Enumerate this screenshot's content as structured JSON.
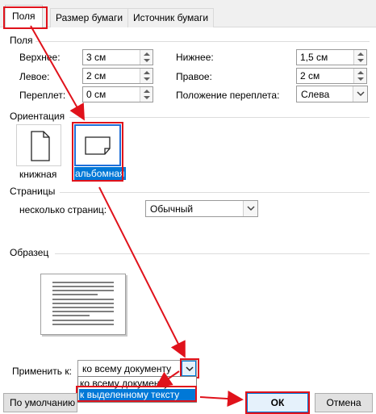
{
  "tabs": [
    "Поля",
    "Размер бумаги",
    "Источник бумаги"
  ],
  "margins": {
    "section_title": "Поля",
    "top_label": "Верхнее:",
    "top_value": "3 см",
    "bottom_label": "Нижнее:",
    "bottom_value": "1,5 см",
    "left_label": "Левое:",
    "left_value": "2 см",
    "right_label": "Правое:",
    "right_value": "2 см",
    "gutter_label": "Переплет:",
    "gutter_value": "0 см",
    "gutter_pos_label": "Положение переплета:",
    "gutter_pos_value": "Слева"
  },
  "orientation": {
    "section_title": "Ориентация",
    "portrait_label": "книжная",
    "landscape_label": "альбомная",
    "selected": "альбомная"
  },
  "pages": {
    "section_title": "Страницы",
    "multiple_label": "несколько страниц:",
    "multiple_value": "Обычный"
  },
  "preview": {
    "section_title": "Образец"
  },
  "apply": {
    "label": "Применить к:",
    "value": "ко всему документу",
    "options": [
      "ко всему документу",
      "к выделенному тексту"
    ],
    "highlighted": "к выделенному тексту"
  },
  "buttons": {
    "default": "По умолчанию",
    "ok": "ОК",
    "cancel": "Отмена"
  },
  "colors": {
    "annotation_red": "#e0121b",
    "selection_blue": "#0078d7",
    "accent_blue": "#1e6fd9"
  }
}
